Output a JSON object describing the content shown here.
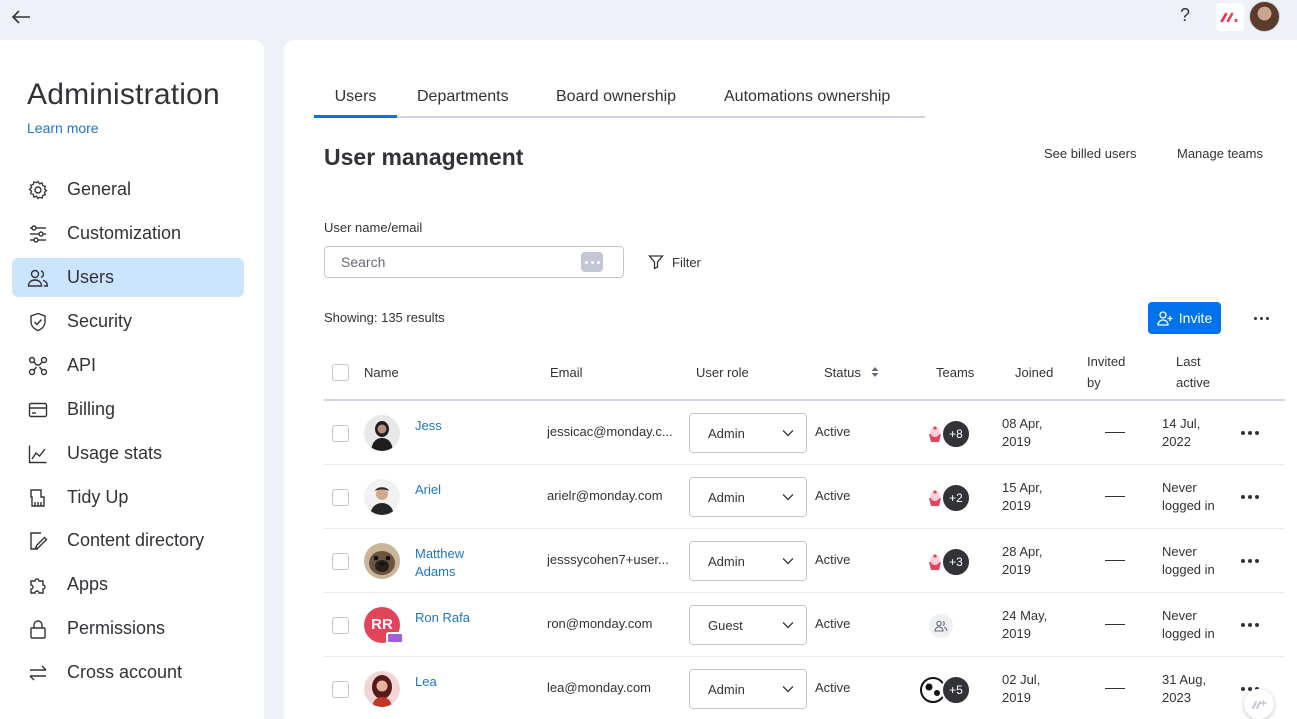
{
  "app": {
    "back_label": "Back",
    "help_label": "?",
    "accent": "#0073ea",
    "link_color": "#1f76c2"
  },
  "sidebar": {
    "title": "Administration",
    "learn_more": "Learn more",
    "items": [
      {
        "label": "General",
        "icon": "gear-icon"
      },
      {
        "label": "Customization",
        "icon": "sliders-icon"
      },
      {
        "label": "Users",
        "icon": "users-icon",
        "active": true
      },
      {
        "label": "Security",
        "icon": "shield-icon"
      },
      {
        "label": "API",
        "icon": "api-icon"
      },
      {
        "label": "Billing",
        "icon": "credit-card-icon"
      },
      {
        "label": "Usage stats",
        "icon": "chart-icon"
      },
      {
        "label": "Tidy Up",
        "icon": "broom-icon"
      },
      {
        "label": "Content directory",
        "icon": "document-edit-icon"
      },
      {
        "label": "Apps",
        "icon": "puzzle-icon"
      },
      {
        "label": "Permissions",
        "icon": "lock-icon"
      },
      {
        "label": "Cross account",
        "icon": "swap-icon"
      }
    ]
  },
  "tabs": [
    {
      "label": "Users",
      "active": true
    },
    {
      "label": "Departments"
    },
    {
      "label": "Board ownership"
    },
    {
      "label": "Automations ownership"
    }
  ],
  "page": {
    "title": "User management",
    "see_billed": "See billed users",
    "manage_teams": "Manage teams",
    "search_label": "User name/email",
    "search_placeholder": "Search",
    "filter_label": "Filter",
    "showing": "Showing: 135 results",
    "invite_label": "Invite"
  },
  "table": {
    "headers": {
      "name": "Name",
      "email": "Email",
      "role": "User role",
      "status": "Status",
      "teams": "Teams",
      "joined": "Joined",
      "invited_1": "Invited",
      "invited_2": "by",
      "last_1": "Last",
      "last_2": "active"
    },
    "rows": [
      {
        "name": "Jess",
        "email": "jessicac@monday.c...",
        "role": "Admin",
        "status": "Active",
        "teams": "+8",
        "joined_1": "08 Apr,",
        "joined_2": "2019",
        "last_1": "14 Jul,",
        "last_2": "2022"
      },
      {
        "name": "Ariel",
        "email": "arielr@monday.com",
        "role": "Admin",
        "status": "Active",
        "teams": "+2",
        "joined_1": "15 Apr,",
        "joined_2": "2019",
        "last_1": "Never",
        "last_2": "logged in"
      },
      {
        "name_1": "Matthew",
        "name_2": "Adams",
        "email": "jesssycohen7+user...",
        "role": "Admin",
        "status": "Active",
        "teams": "+3",
        "joined_1": "28 Apr,",
        "joined_2": "2019",
        "last_1": "Never",
        "last_2": "logged in"
      },
      {
        "name": "Ron Rafa",
        "initials": "RR",
        "email": "ron@monday.com",
        "role": "Guest",
        "status": "Active",
        "teams": "",
        "joined_1": "24 May,",
        "joined_2": "2019",
        "last_1": "Never",
        "last_2": "logged in"
      },
      {
        "name": "Lea",
        "email": "lea@monday.com",
        "role": "Admin",
        "status": "Active",
        "teams": "+5",
        "joined_1": "02 Jul,",
        "joined_2": "2019",
        "last_1": "31 Aug,",
        "last_2": "2023"
      }
    ]
  }
}
